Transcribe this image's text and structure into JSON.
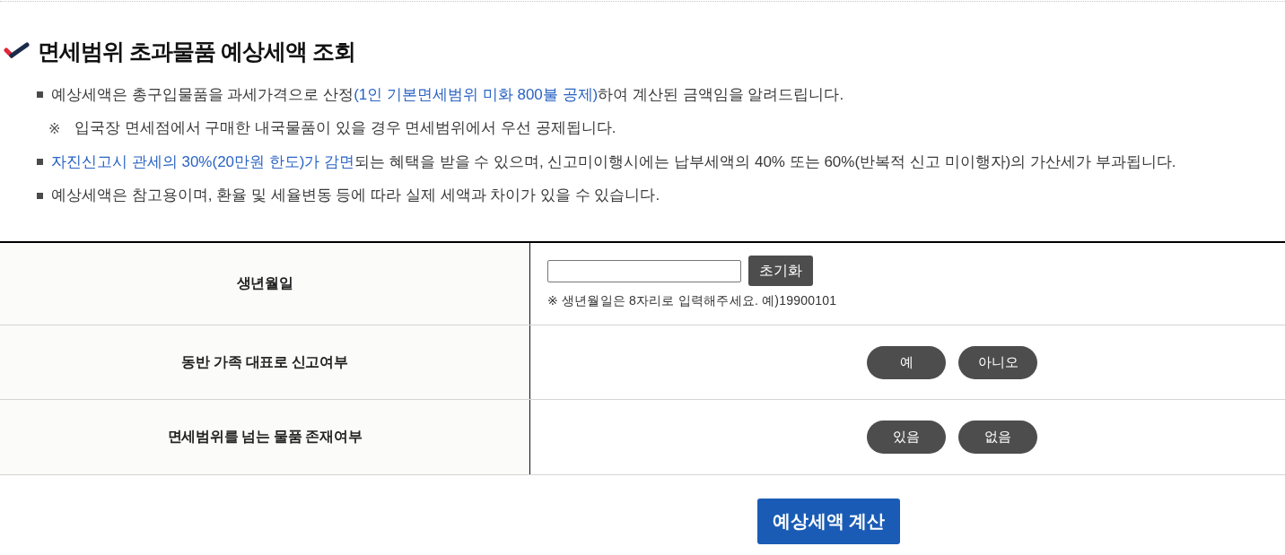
{
  "header": {
    "title": "면세범위 초과물품 예상세액 조회"
  },
  "notes": [
    {
      "kind": "bullet",
      "segments": [
        {
          "text": "예상세액은 총구입물품을 과세가격으로 산정",
          "highlight": false
        },
        {
          "text": "(1인 기본면세범위 미화 800불 공제)",
          "highlight": true
        },
        {
          "text": "하여 계산된 금액임을 알려드립니다.",
          "highlight": false
        }
      ]
    },
    {
      "kind": "note",
      "mark": "※",
      "segments": [
        {
          "text": "입국장 면세점에서 구매한 내국물품이 있을 경우 면세범위에서 우선 공제됩니다.",
          "highlight": false
        }
      ]
    },
    {
      "kind": "bullet",
      "segments": [
        {
          "text": "자진신고시 관세의 30%(20만원 한도)가 감면",
          "highlight": true
        },
        {
          "text": "되는 혜택을 받을 수 있으며, 신고미이행시에는 납부세액의 40% 또는 60%(반복적 신고 미이행자)의 가산세가 부과됩니다.",
          "highlight": false
        }
      ]
    },
    {
      "kind": "bullet",
      "segments": [
        {
          "text": "예상세액은 참고용이며, 환율 및 세율변동 등에 따라 실제 세액과 차이가 있을 수 있습니다.",
          "highlight": false
        }
      ]
    }
  ],
  "form": {
    "rows": [
      {
        "kind": "date_input",
        "label": "생년월일",
        "reset_button": "초기화",
        "hint": "※ 생년월일은 8자리로 입력해주세요. 예)19900101"
      },
      {
        "kind": "choice",
        "label": "동반 가족 대표로 신고여부",
        "options": [
          {
            "label": "예",
            "selected": false
          },
          {
            "label": "아니오",
            "selected": false
          }
        ]
      },
      {
        "kind": "choice",
        "label": "면세범위를 넘는 물품 존재여부",
        "options": [
          {
            "label": "있음",
            "selected": false
          },
          {
            "label": "없음",
            "selected": false
          }
        ]
      }
    ]
  },
  "submit_button": "예상세액 계산"
}
